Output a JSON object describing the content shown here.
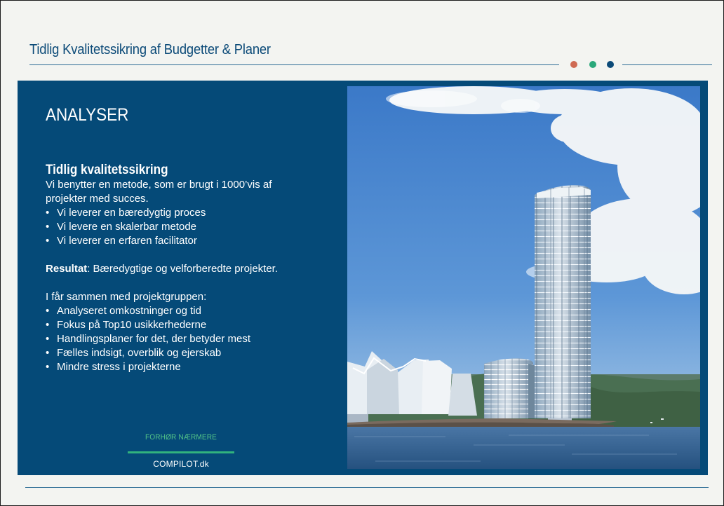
{
  "slide": {
    "title": "Tidlig Kvalitetssikring af Budgetter & Planer",
    "heading": "ANALYSER",
    "subheading": "Tidlig kvalitetssikring",
    "intro_lines": [
      "Vi benytter en metode, som er brugt i 1000’vis af",
      "projekter med succes."
    ],
    "bullets_one": [
      "Vi leverer en bæredygtig proces",
      "Vi levere en skalerbar metode",
      "Vi leverer en erfaren facilitator"
    ],
    "result_label": "Resultat",
    "result_text": ": Bæredygtige og velforberedte projekter.",
    "group_intro": "I får sammen med projektgruppen:",
    "bullets_two": [
      "Analyseret omkostninger og tid",
      "Fokus på Top10 usikkerhederne",
      "Handlingsplaner for det, der betyder mest",
      "Fælles indsigt, overblik og ejerskab",
      "Mindre stress i projekterne"
    ],
    "cta_text": "FORHØR NÆRMERE",
    "domain": "COMPILOT.dk"
  },
  "colors": {
    "panel": "#054a78",
    "accent_red": "#cf6a53",
    "accent_green": "#2aa87a",
    "accent_navy": "#0b4a78"
  },
  "icons": {
    "indicator_dots": [
      "red-dot-icon",
      "green-dot-icon",
      "navy-dot-icon"
    ]
  }
}
